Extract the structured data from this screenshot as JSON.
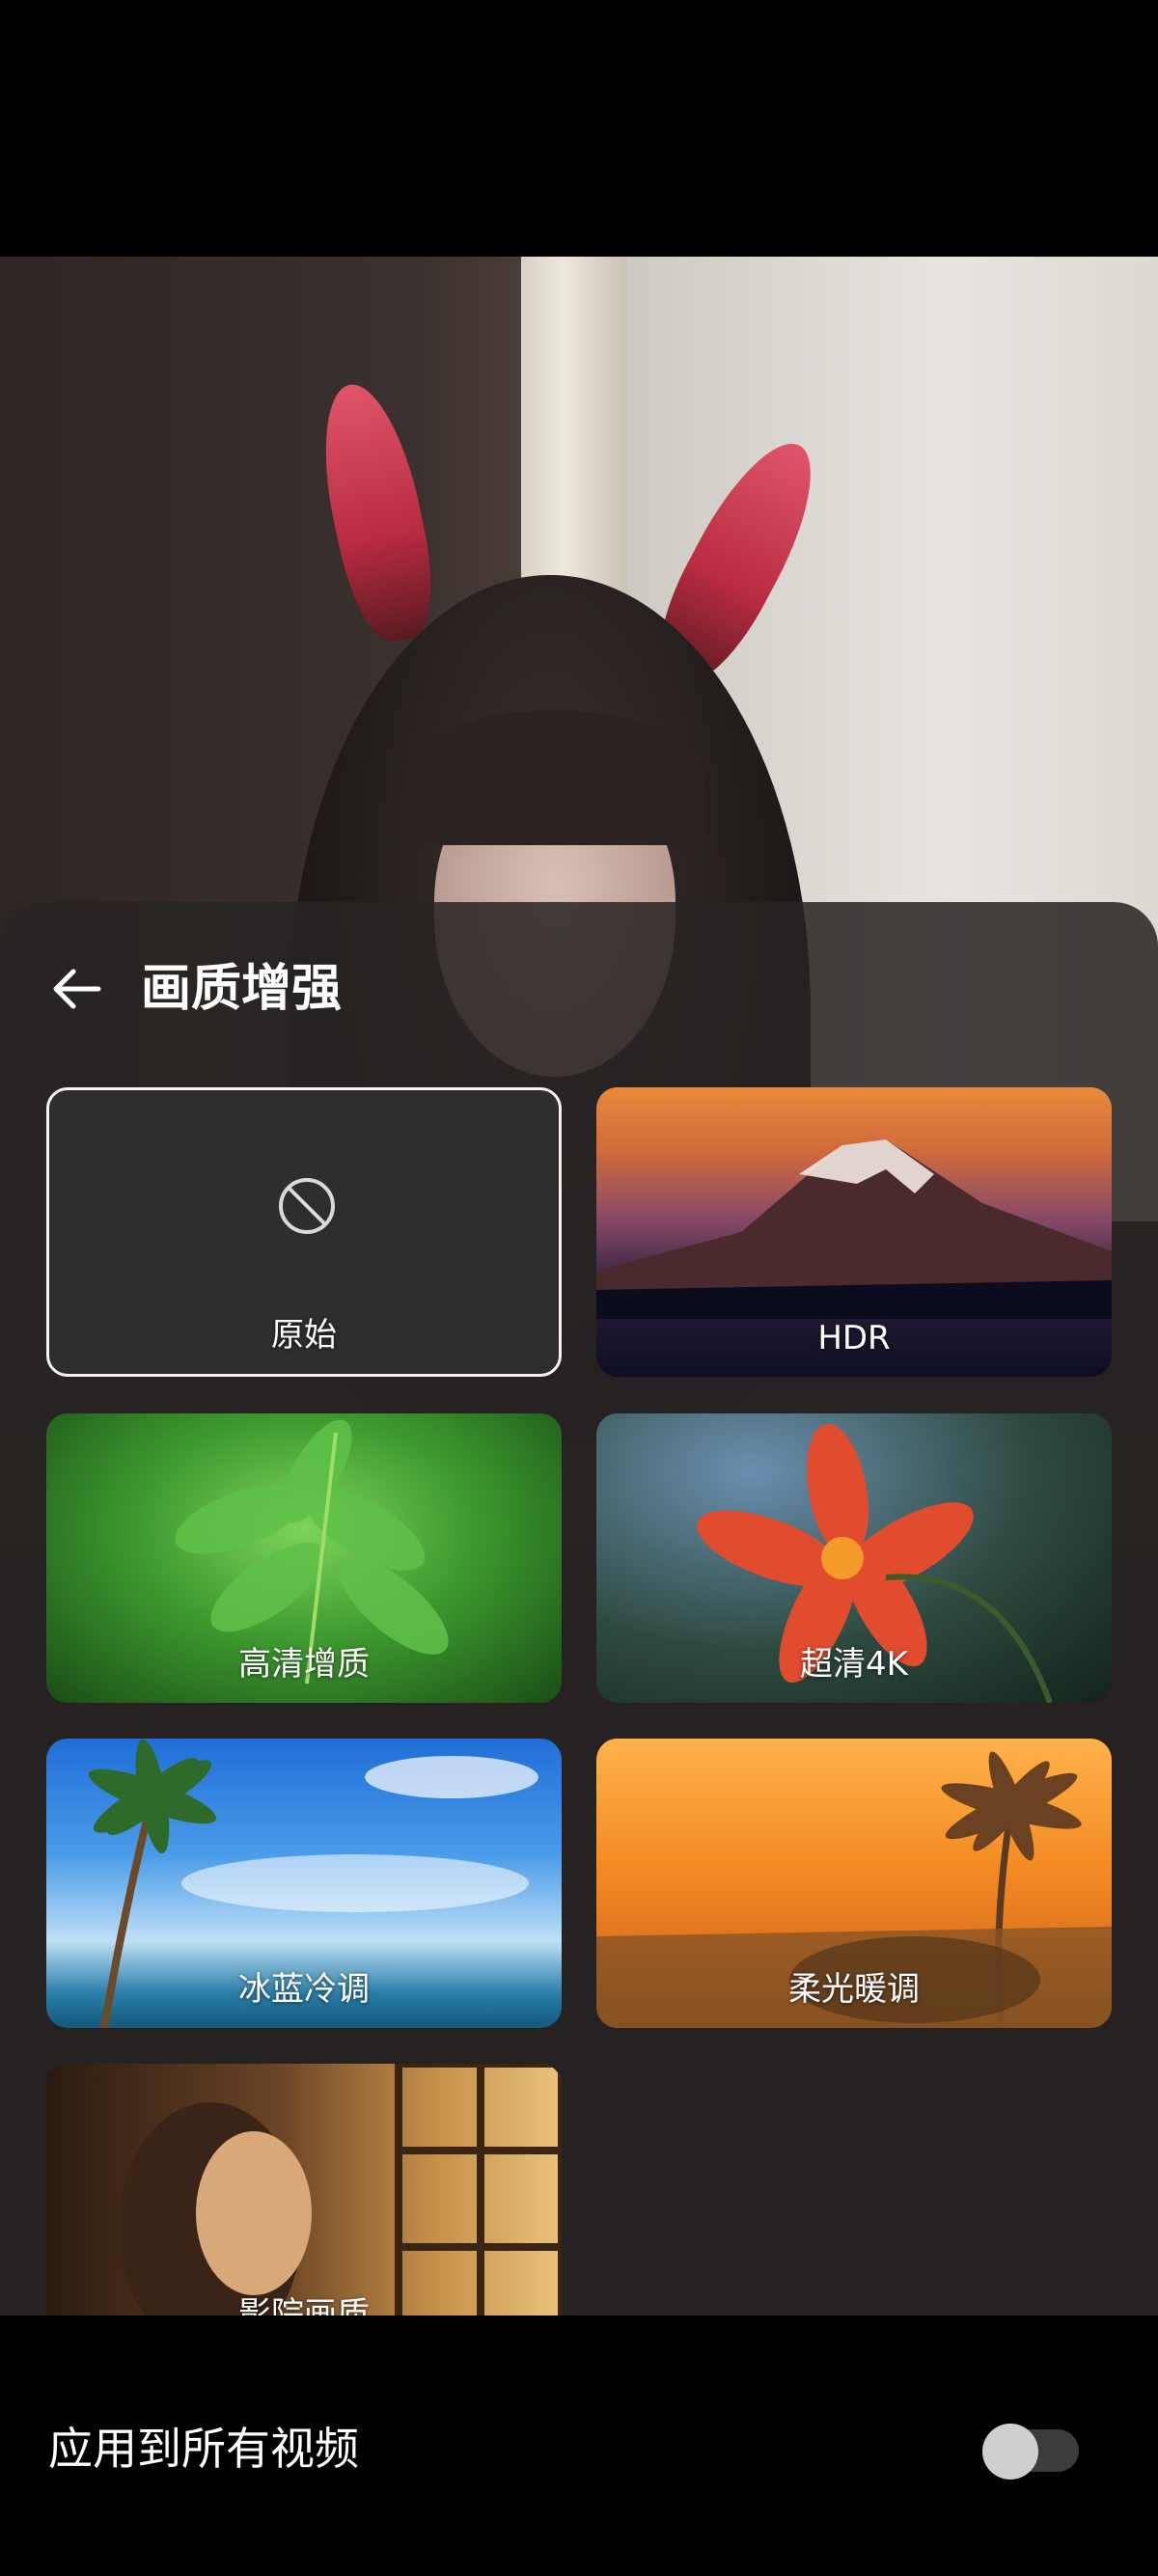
{
  "sheet": {
    "title": "画质增强",
    "options": [
      {
        "label": "原始",
        "selected": true,
        "icon": "prohibited-icon"
      },
      {
        "label": "HDR",
        "selected": false
      },
      {
        "label": "高清增质",
        "selected": false
      },
      {
        "label": "超清4K",
        "selected": false
      },
      {
        "label": "冰蓝冷调",
        "selected": false
      },
      {
        "label": "柔光暖调",
        "selected": false
      },
      {
        "label": "影院画质",
        "selected": false
      }
    ]
  },
  "apply_all": {
    "label": "应用到所有视频",
    "enabled": false
  },
  "colors": {
    "sheet_bg": "#282423",
    "selected_border": "#f2f2f2",
    "toggle_off": "#3c3c3c"
  }
}
